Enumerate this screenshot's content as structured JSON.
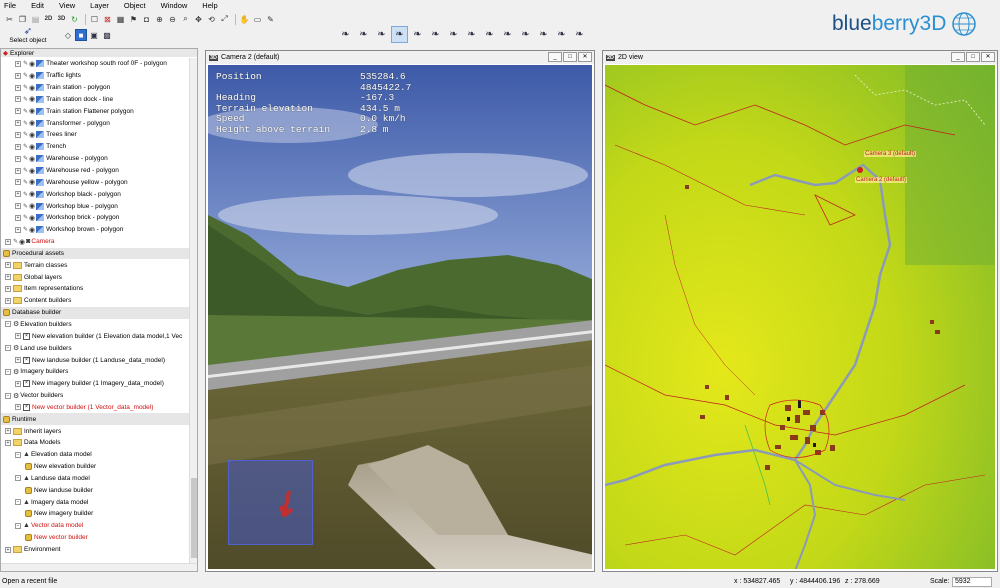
{
  "menu": [
    "File",
    "Edit",
    "View",
    "Layer",
    "Object",
    "Window",
    "Help"
  ],
  "logo": {
    "part1": "blue",
    "part2": "berry3D"
  },
  "toolbar": {
    "select_object_label": "Select object"
  },
  "explorer": {
    "title": "Explorer",
    "rows": [
      {
        "label": "Theater workshop south roof 0F - polygon",
        "type": "layer",
        "depth": 1
      },
      {
        "label": "Traffic lights",
        "type": "layer",
        "depth": 1
      },
      {
        "label": "Train station - polygon",
        "type": "layer",
        "depth": 1
      },
      {
        "label": "Train station dock - line",
        "type": "layer",
        "depth": 1
      },
      {
        "label": "Train station Flattener polygon",
        "type": "layer",
        "depth": 1
      },
      {
        "label": "Transformer - polygon",
        "type": "layer",
        "depth": 1
      },
      {
        "label": "Trees liner",
        "type": "layer",
        "depth": 1
      },
      {
        "label": "Trench",
        "type": "layer",
        "depth": 1
      },
      {
        "label": "Warehouse - polygon",
        "type": "layer",
        "depth": 1
      },
      {
        "label": "Warehouse red - polygon",
        "type": "layer",
        "depth": 1
      },
      {
        "label": "Warehouse yellow - polygon",
        "type": "layer",
        "depth": 1
      },
      {
        "label": "Workshop black - polygon",
        "type": "layer",
        "depth": 1
      },
      {
        "label": "Workshop blue - polygon",
        "type": "layer",
        "depth": 1
      },
      {
        "label": "Workshop brick - polygon",
        "type": "layer",
        "depth": 1
      },
      {
        "label": "Workshop brown - polygon",
        "type": "layer",
        "depth": 1
      },
      {
        "label": "Camera",
        "type": "camera",
        "depth": 0,
        "red": true
      },
      {
        "label": "Procedural assets",
        "type": "section"
      },
      {
        "label": "Terrain classes",
        "type": "folder",
        "depth": 0
      },
      {
        "label": "Global layers",
        "type": "folder",
        "depth": 0
      },
      {
        "label": "Item representations",
        "type": "folder",
        "depth": 0
      },
      {
        "label": "Content builders",
        "type": "folder",
        "depth": 0
      },
      {
        "label": "Database builder",
        "type": "section"
      },
      {
        "label": "Elevation builders",
        "type": "builder",
        "depth": 0
      },
      {
        "label": "New elevation builder (1 Elevation data model,1 Vec",
        "type": "item",
        "depth": 1
      },
      {
        "label": "Land use builders",
        "type": "builder",
        "depth": 0
      },
      {
        "label": "New landuse builder (1 Landuse_data_model)",
        "type": "item",
        "depth": 1
      },
      {
        "label": "Imagery builders",
        "type": "builder",
        "depth": 0
      },
      {
        "label": "New imagery builder (1 Imagery_data_model)",
        "type": "item",
        "depth": 1
      },
      {
        "label": "Vector builders",
        "type": "builder",
        "depth": 0
      },
      {
        "label": "New vector builder (1 Vector_data_model)",
        "type": "item",
        "depth": 1,
        "red": true
      },
      {
        "label": "Runtime",
        "type": "section"
      },
      {
        "label": "Inherit layers",
        "type": "folder",
        "depth": 0
      },
      {
        "label": "Data Models",
        "type": "folder",
        "depth": 0
      },
      {
        "label": "Elevation data model",
        "type": "model",
        "depth": 1
      },
      {
        "label": "New elevation builder",
        "type": "cube",
        "depth": 2
      },
      {
        "label": "Landuse data model",
        "type": "model",
        "depth": 1
      },
      {
        "label": "New landuse builder",
        "type": "cube",
        "depth": 2
      },
      {
        "label": "Imagery data model",
        "type": "model",
        "depth": 1
      },
      {
        "label": "New imagery builder",
        "type": "cube",
        "depth": 2
      },
      {
        "label": "Vector data model",
        "type": "model",
        "depth": 1,
        "red": true
      },
      {
        "label": "New vector builder",
        "type": "cube",
        "depth": 2,
        "red": true
      },
      {
        "label": "Environment",
        "type": "folder",
        "depth": 0
      }
    ]
  },
  "camera_panel": {
    "badge": "3D",
    "title": "Camera 2 (default)",
    "hud": [
      {
        "k": "Position",
        "v": "535284.6"
      },
      {
        "k": "",
        "v": "4845422.7"
      },
      {
        "k": "Heading",
        "v": "-167.3"
      },
      {
        "k": "Terrain elevation",
        "v": "434.5 m"
      },
      {
        "k": "Speed",
        "v": "0.0 km/h"
      },
      {
        "k": "Height above terrain",
        "v": "2.8 m"
      }
    ]
  },
  "map_panel": {
    "badge": "2D",
    "title": "2D view",
    "camera_labels": [
      "Camera 3 (default)",
      "Camera 2 (default)"
    ]
  },
  "window_buttons": [
    "_",
    "□",
    "✕"
  ],
  "status": {
    "hint": "Open a recent file",
    "x": "x : 534827.465",
    "y": "y : 4844406.196",
    "z": "z : 278.669",
    "scale_label": "Scale:",
    "scale_value": "5932"
  },
  "colors": {
    "accent": "#2f6fd0",
    "map_ground": "#c8dc18",
    "road": "#8a9ab8",
    "red_layer": "#d01010"
  }
}
